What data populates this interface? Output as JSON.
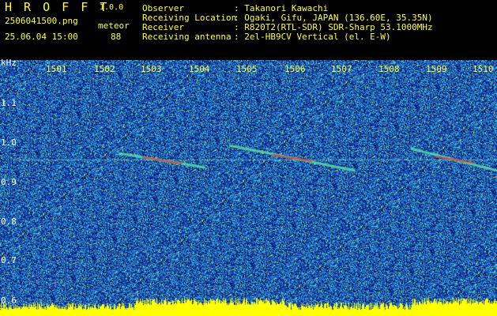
{
  "app": {
    "logo": "H R O F F T",
    "version": "1.0.0"
  },
  "file": {
    "name": "2506041500.png",
    "datetime": "25.06.04 15:00"
  },
  "mode": {
    "label": "meteor",
    "count": "88"
  },
  "info": [
    {
      "label": "Observer",
      "value": ": Takanori Kawachi"
    },
    {
      "label": "Receiving Location",
      "value": ": Ogaki, Gifu, JAPAN (136.60E, 35.35N)"
    },
    {
      "label": "Receiver",
      "value": ": R820T2(RTL-SDR) SDR-Sharp 53.1000MHz"
    },
    {
      "label": "Receiving antenna",
      "value": ": 2el-HB9CV Vertical (el. E-W)"
    }
  ],
  "axis": {
    "unit": "kHz",
    "seconds": [
      "1501",
      "1502",
      "1503",
      "1504",
      "1505",
      "1506",
      "1507",
      "1508",
      "1509",
      "1510"
    ],
    "khz": [
      "1.1",
      "1.0",
      "0.9",
      "0.8",
      "0.7",
      "0.6"
    ]
  },
  "colors": {
    "text_yellow": "#ffff40",
    "text_green": "#40ff40",
    "text_white": "#ffffff",
    "background_blue": "#1a3aa8",
    "meter_yellow": "#ffff00"
  }
}
